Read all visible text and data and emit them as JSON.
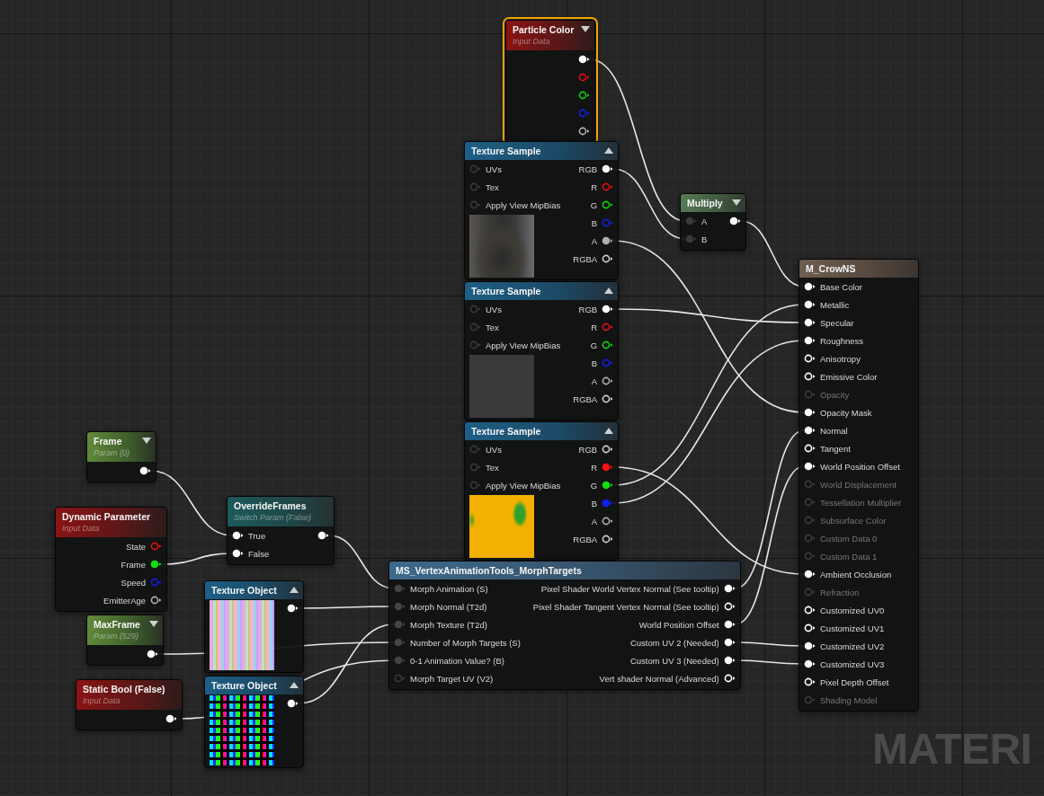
{
  "graph_label": "MATERI",
  "nodes": [
    {
      "kind": "input",
      "title": "Particle Color",
      "subtitle": "Input Data",
      "expanded": false,
      "selected": true,
      "outputs": [
        {
          "connected": true,
          "color": "#ffffff"
        },
        {
          "connected": false,
          "color": "#e01010"
        },
        {
          "connected": false,
          "color": "#10d010"
        },
        {
          "connected": false,
          "color": "#1020e0"
        },
        {
          "connected": false,
          "color": "#b0b0b0"
        }
      ]
    },
    {
      "kind": "texture",
      "title": "Texture Sample",
      "expanded": true,
      "selected": false,
      "preview": {
        "kind": "photo"
      },
      "inputs": [
        {
          "label": "UVs",
          "connected": false,
          "color": "#3a3a3a"
        },
        {
          "label": "Tex",
          "connected": false,
          "color": "#3a3a3a"
        },
        {
          "label": "Apply View MipBias",
          "connected": false,
          "color": "#3a3a3a"
        }
      ],
      "outputs": [
        {
          "label": "RGB",
          "connected": true,
          "color": "#ffffff"
        },
        {
          "label": "R",
          "connected": false,
          "color": "#e01010"
        },
        {
          "label": "G",
          "connected": false,
          "color": "#10d010"
        },
        {
          "label": "B",
          "connected": false,
          "color": "#1020e0"
        },
        {
          "label": "A",
          "connected": true,
          "color": "#b0b0b0"
        },
        {
          "label": "RGBA",
          "connected": false,
          "color": "#d0d0d0"
        }
      ]
    },
    {
      "kind": "texture",
      "title": "Texture Sample",
      "expanded": true,
      "selected": false,
      "preview": {
        "kind": "flat"
      },
      "inputs": [
        {
          "label": "UVs",
          "connected": false,
          "color": "#3a3a3a"
        },
        {
          "label": "Tex",
          "connected": false,
          "color": "#3a3a3a"
        },
        {
          "label": "Apply View MipBias",
          "connected": false,
          "color": "#3a3a3a"
        }
      ],
      "outputs": [
        {
          "label": "RGB",
          "connected": true,
          "color": "#ffffff"
        },
        {
          "label": "R",
          "connected": false,
          "color": "#e01010"
        },
        {
          "label": "G",
          "connected": false,
          "color": "#10d010"
        },
        {
          "label": "B",
          "connected": false,
          "color": "#1020e0"
        },
        {
          "label": "A",
          "connected": false,
          "color": "#b0b0b0"
        },
        {
          "label": "RGBA",
          "connected": false,
          "color": "#d0d0d0"
        }
      ]
    },
    {
      "kind": "texture",
      "title": "Texture Sample",
      "expanded": true,
      "selected": false,
      "preview": {
        "kind": "mask"
      },
      "inputs": [
        {
          "label": "UVs",
          "connected": false,
          "color": "#3a3a3a"
        },
        {
          "label": "Tex",
          "connected": false,
          "color": "#3a3a3a"
        },
        {
          "label": "Apply View MipBias",
          "connected": false,
          "color": "#3a3a3a"
        }
      ],
      "outputs": [
        {
          "label": "RGB",
          "connected": false,
          "color": "#d0d0d0"
        },
        {
          "label": "R",
          "connected": true,
          "color": "#ff1010"
        },
        {
          "label": "G",
          "connected": true,
          "color": "#10e010"
        },
        {
          "label": "B",
          "connected": true,
          "color": "#1020f0"
        },
        {
          "label": "A",
          "connected": false,
          "color": "#b0b0b0"
        },
        {
          "label": "RGBA",
          "connected": false,
          "color": "#d0d0d0"
        }
      ]
    },
    {
      "kind": "math",
      "title": "Multiply",
      "expanded": false,
      "selected": false,
      "inputs": [
        {
          "label": "A",
          "connected": true,
          "color": "#3a3a3a"
        },
        {
          "label": "B",
          "connected": true,
          "color": "#3a3a3a"
        }
      ],
      "outputs": [
        {
          "connected": true,
          "color": "#ffffff"
        }
      ]
    },
    {
      "kind": "result",
      "title": "M_CrowNS",
      "selected": false,
      "inputs": [
        {
          "label": "Base Color",
          "connected": true,
          "disabled": false,
          "color": "#ffffff"
        },
        {
          "label": "Metallic",
          "connected": true,
          "disabled": false,
          "color": "#ffffff"
        },
        {
          "label": "Specular",
          "connected": true,
          "disabled": false,
          "color": "#ffffff"
        },
        {
          "label": "Roughness",
          "connected": true,
          "disabled": false,
          "color": "#ffffff"
        },
        {
          "label": "Anisotropy",
          "connected": false,
          "disabled": false,
          "color": "#ffffff"
        },
        {
          "label": "Emissive Color",
          "connected": false,
          "disabled": false,
          "color": "#ffffff"
        },
        {
          "label": "Opacity",
          "connected": false,
          "disabled": true,
          "color": "#3c3c3c"
        },
        {
          "label": "Opacity Mask",
          "connected": true,
          "disabled": false,
          "color": "#ffffff"
        },
        {
          "label": "Normal",
          "connected": true,
          "disabled": false,
          "color": "#ffffff"
        },
        {
          "label": "Tangent",
          "connected": false,
          "disabled": false,
          "color": "#ffffff"
        },
        {
          "label": "World Position Offset",
          "connected": true,
          "disabled": false,
          "color": "#ffffff"
        },
        {
          "label": "World Displacement",
          "connected": false,
          "disabled": true,
          "color": "#3c3c3c"
        },
        {
          "label": "Tessellation Multiplier",
          "connected": false,
          "disabled": true,
          "color": "#3c3c3c"
        },
        {
          "label": "Subsurface Color",
          "connected": false,
          "disabled": true,
          "color": "#3c3c3c"
        },
        {
          "label": "Custom Data 0",
          "connected": false,
          "disabled": true,
          "color": "#3c3c3c"
        },
        {
          "label": "Custom Data 1",
          "connected": false,
          "disabled": true,
          "color": "#3c3c3c"
        },
        {
          "label": "Ambient Occlusion",
          "connected": true,
          "disabled": false,
          "color": "#ffffff"
        },
        {
          "label": "Refraction",
          "connected": false,
          "disabled": true,
          "color": "#3c3c3c"
        },
        {
          "label": "Customized UV0",
          "connected": false,
          "disabled": false,
          "color": "#ffffff"
        },
        {
          "label": "Customized UV1",
          "connected": false,
          "disabled": false,
          "color": "#ffffff"
        },
        {
          "label": "Customized UV2",
          "connected": true,
          "disabled": false,
          "color": "#ffffff"
        },
        {
          "label": "Customized UV3",
          "connected": true,
          "disabled": false,
          "color": "#ffffff"
        },
        {
          "label": "Pixel Depth Offset",
          "connected": false,
          "disabled": false,
          "color": "#ffffff"
        },
        {
          "label": "Shading Model",
          "connected": false,
          "disabled": true,
          "color": "#3c3c3c"
        }
      ]
    },
    {
      "kind": "param",
      "title": "Frame",
      "subtitle": "Param (0)",
      "expanded": false,
      "selected": false,
      "outputs": [
        {
          "connected": true,
          "color": "#ffffff"
        }
      ]
    },
    {
      "kind": "input",
      "title": "Dynamic Parameter",
      "subtitle": "Input Data",
      "selected": false,
      "outputs": [
        {
          "label": "State",
          "connected": false,
          "color": "#e01010"
        },
        {
          "label": "Frame",
          "connected": true,
          "color": "#10e010"
        },
        {
          "label": "Speed",
          "connected": false,
          "color": "#1020e0"
        },
        {
          "label": "EmitterAge",
          "connected": false,
          "color": "#b0b0b0"
        }
      ]
    },
    {
      "kind": "switch",
      "title": "OverrideFrames",
      "subtitle": "Switch Param (False)",
      "selected": false,
      "inputs": [
        {
          "label": "True",
          "connected": true,
          "color": "#ffffff"
        },
        {
          "label": "False",
          "connected": true,
          "color": "#ffffff"
        }
      ],
      "outputs": [
        {
          "connected": true,
          "color": "#ffffff"
        }
      ]
    },
    {
      "kind": "texture",
      "title": "Texture Object",
      "expanded": true,
      "selected": false,
      "preview": {
        "kind": "noise"
      },
      "outputs": [
        {
          "connected": true,
          "color": "#ffffff"
        }
      ]
    },
    {
      "kind": "param",
      "title": "MaxFrame",
      "subtitle": "Param (529)",
      "expanded": false,
      "selected": false,
      "outputs": [
        {
          "connected": true,
          "color": "#ffffff"
        }
      ]
    },
    {
      "kind": "function",
      "title": "MS_VertexAnimationTools_MorphTargets",
      "selected": false,
      "inputs": [
        {
          "label": "Morph Animation (S)",
          "connected": true,
          "color": "#444444"
        },
        {
          "label": "Morph Normal (T2d)",
          "connected": true,
          "color": "#444444"
        },
        {
          "label": "Morph Texture (T2d)",
          "connected": true,
          "color": "#444444"
        },
        {
          "label": "Number of Morph Targets (S)",
          "connected": true,
          "color": "#444444"
        },
        {
          "label": "0-1 Animation Value? (B)",
          "connected": true,
          "color": "#444444"
        },
        {
          "label": "Morph Target UV (V2)",
          "connected": false,
          "color": "#3a3a3a"
        }
      ],
      "outputs": [
        {
          "label": "Pixel Shader World Vertex Normal (See tooltip)",
          "connected": true,
          "color": "#ffffff"
        },
        {
          "label": "Pixel Shader Tangent Vertex Normal (See tooltip)",
          "connected": false,
          "color": "#ffffff"
        },
        {
          "label": "World Position Offset",
          "connected": true,
          "color": "#ffffff"
        },
        {
          "label": "Custom UV 2 (Needed)",
          "connected": true,
          "color": "#ffffff"
        },
        {
          "label": "Custom UV 3 (Needed)",
          "connected": true,
          "color": "#ffffff"
        },
        {
          "label": "Vert shader Normal (Advanced)",
          "connected": false,
          "color": "#ffffff"
        }
      ]
    },
    {
      "kind": "input",
      "title": "Static Bool (False)",
      "subtitle": "Input Data",
      "selected": false,
      "outputs": [
        {
          "connected": true,
          "color": "#ffffff"
        }
      ]
    },
    {
      "kind": "texture",
      "title": "Texture Object",
      "expanded": true,
      "selected": false,
      "preview": {
        "kind": "noise-dark"
      },
      "outputs": [
        {
          "connected": true,
          "color": "#ffffff"
        }
      ]
    }
  ]
}
